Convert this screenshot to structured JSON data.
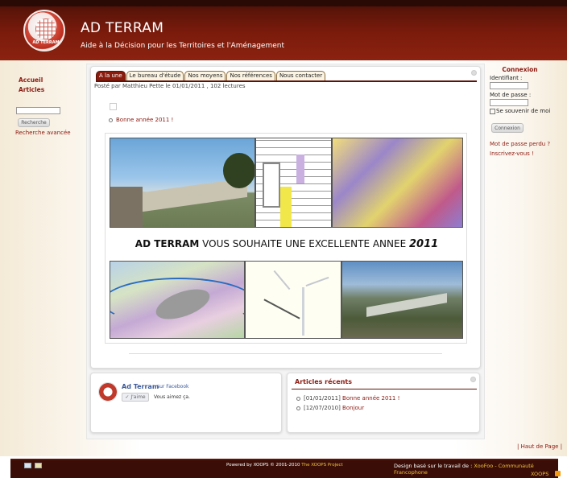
{
  "header": {
    "logo_text": "AD TERRAM",
    "site_title": "AD TERRAM",
    "slogan": "Aide à la Décision pour les Territoires et l'Aménagement"
  },
  "left_nav": {
    "items": [
      {
        "label": "Accueil"
      },
      {
        "label": "Articles"
      }
    ],
    "search_button": "Recherche",
    "advanced_search": "Recherche avancée"
  },
  "tabs": [
    {
      "label": "A la une",
      "active": true
    },
    {
      "label": "Le bureau d'étude",
      "active": false
    },
    {
      "label": "Nos moyens",
      "active": false
    },
    {
      "label": "Nos références",
      "active": false
    },
    {
      "label": "Nous contacter",
      "active": false
    }
  ],
  "article": {
    "byline": "Posté par Matthieu Pette le 01/01/2011 , 102 lectures",
    "link": "Bonne année 2011 !",
    "greeting_brand": "AD TERRAM",
    "greeting_middle": " VOUS SOUHAITE UNE EXCELLENTE ANNEE ",
    "greeting_year": "2011"
  },
  "facebook": {
    "name": "Ad Terram",
    "suffix": "sur Facebook",
    "like_button": "J'aime",
    "like_text": "Vous aimez ça."
  },
  "recent_articles": {
    "title": "Articles récents",
    "items": [
      {
        "date": "[01/01/2011]",
        "title": "Bonne année 2011 !"
      },
      {
        "date": "[12/07/2010]",
        "title": "Bonjour"
      }
    ]
  },
  "login": {
    "title": "Connexion",
    "username_label": "Identifiant :",
    "password_label": "Mot de passe :",
    "remember_label": "Se souvenir de moi",
    "button": "Connexion",
    "lost_password": "Mot de passe perdu ?",
    "register": "Inscrivez-vous !"
  },
  "top_of_page": "| Haut de Page |",
  "footer": {
    "powered_prefix": "Powered by XOOPS © 2001-2010 ",
    "powered_link": "The XOOPS Project",
    "design_prefix": "Design basé sur le travail de : ",
    "design_link": "XooFoo - Communauté Francophone",
    "xoops": "XOOPS"
  },
  "colors": {
    "brand_dark_red": "#8b1a10",
    "header_red": "#7a1b0c",
    "tab_active": "#8a1b0d",
    "facebook_blue": "#3b5998"
  }
}
